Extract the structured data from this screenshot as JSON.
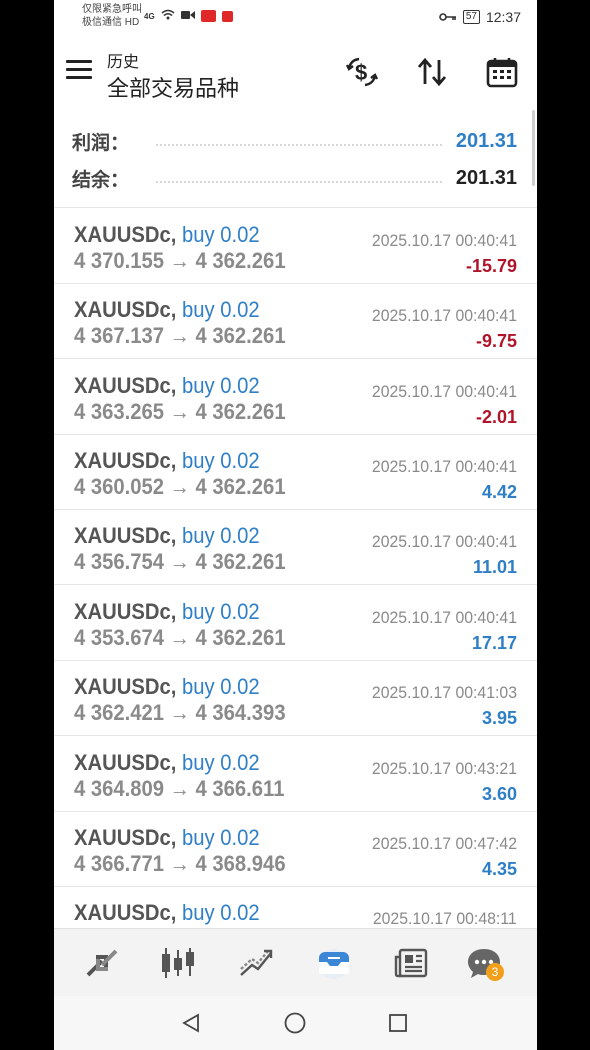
{
  "status_bar": {
    "carrier_line1": "仅限紧急呼叫",
    "carrier_line2": "极信通信 HD",
    "network": "4G",
    "battery": "57",
    "time": "12:37"
  },
  "header": {
    "title": "历史",
    "subtitle": "全部交易品种",
    "icons": [
      "menu-icon",
      "currency-exchange-icon",
      "sort-icon",
      "calendar-icon"
    ]
  },
  "summary": {
    "profit_label": "利润：",
    "profit_value": "201.31",
    "balance_label": "结余：",
    "balance_value": "201.31",
    "colors": {
      "profit": "#2f7fc7",
      "balance": "#222222"
    }
  },
  "trades": [
    {
      "symbol": "XAUUSDc,",
      "direction": "buy 0.02",
      "prices": "4 370.155 → 4 362.261",
      "time": "2025.10.17 00:40:41",
      "profit": "-15.79",
      "negative": true
    },
    {
      "symbol": "XAUUSDc,",
      "direction": "buy 0.02",
      "prices": "4 367.137 → 4 362.261",
      "time": "2025.10.17 00:40:41",
      "profit": "-9.75",
      "negative": true
    },
    {
      "symbol": "XAUUSDc,",
      "direction": "buy 0.02",
      "prices": "4 363.265 → 4 362.261",
      "time": "2025.10.17 00:40:41",
      "profit": "-2.01",
      "negative": true
    },
    {
      "symbol": "XAUUSDc,",
      "direction": "buy 0.02",
      "prices": "4 360.052 → 4 362.261",
      "time": "2025.10.17 00:40:41",
      "profit": "4.42",
      "negative": false
    },
    {
      "symbol": "XAUUSDc,",
      "direction": "buy 0.02",
      "prices": "4 356.754 → 4 362.261",
      "time": "2025.10.17 00:40:41",
      "profit": "11.01",
      "negative": false
    },
    {
      "symbol": "XAUUSDc,",
      "direction": "buy 0.02",
      "prices": "4 353.674 → 4 362.261",
      "time": "2025.10.17 00:40:41",
      "profit": "17.17",
      "negative": false
    },
    {
      "symbol": "XAUUSDc,",
      "direction": "buy 0.02",
      "prices": "4 362.421 → 4 364.393",
      "time": "2025.10.17 00:41:03",
      "profit": "3.95",
      "negative": false
    },
    {
      "symbol": "XAUUSDc,",
      "direction": "buy 0.02",
      "prices": "4 364.809 → 4 366.611",
      "time": "2025.10.17 00:43:21",
      "profit": "3.60",
      "negative": false
    },
    {
      "symbol": "XAUUSDc,",
      "direction": "buy 0.02",
      "prices": "4 366.771 → 4 368.946",
      "time": "2025.10.17 00:47:42",
      "profit": "4.35",
      "negative": false
    },
    {
      "symbol": "XAUUSDc,",
      "direction": "buy 0.02",
      "prices": "",
      "time": "2025.10.17 00:48:11",
      "profit": "",
      "negative": false
    }
  ],
  "colors": {
    "positive": "#2f7fc7",
    "negative": "#b0142a",
    "accent": "#2f7fc7"
  },
  "bottom_nav": {
    "items": [
      "quotes-icon",
      "chart-icon",
      "trade-icon",
      "history-icon",
      "news-icon",
      "chat-icon"
    ],
    "active": "history-icon",
    "chat_badge": "3"
  },
  "system_nav": [
    "back-icon",
    "home-icon",
    "recents-icon"
  ]
}
